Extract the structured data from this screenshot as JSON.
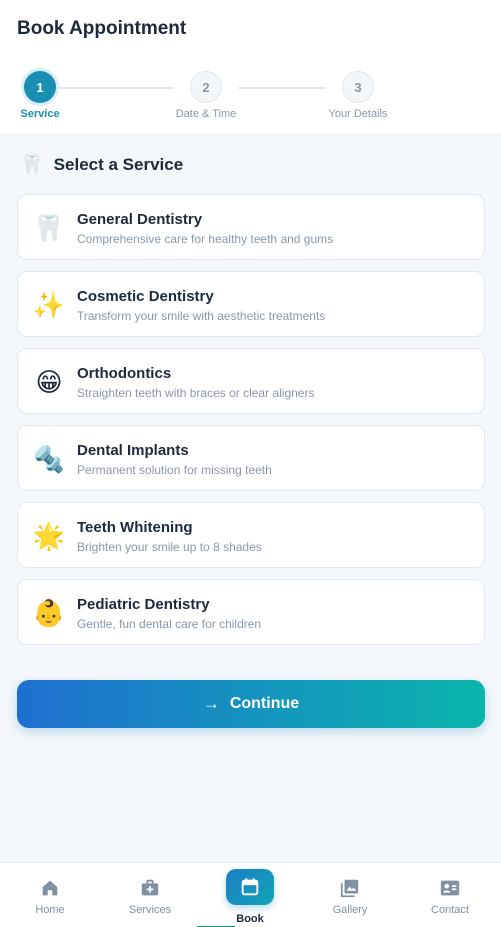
{
  "header": {
    "title": "Book Appointment"
  },
  "steps": [
    {
      "number": "1",
      "label": "Service",
      "state": "active"
    },
    {
      "number": "2",
      "label": "Date & Time",
      "state": "inactive"
    },
    {
      "number": "3",
      "label": "Your Details",
      "state": "inactive"
    }
  ],
  "section": {
    "icon": "tooth-icon",
    "emoji": "🦷",
    "title": "Select a Service"
  },
  "services": [
    {
      "emoji": "🦷",
      "icon": "tooth-icon",
      "title": "General Dentistry",
      "description": "Comprehensive care for healthy teeth and gums"
    },
    {
      "emoji": "✨",
      "icon": "sparkles-icon",
      "title": "Cosmetic Dentistry",
      "description": "Transform your smile with aesthetic treatments"
    },
    {
      "emoji": "😁",
      "icon": "grin-icon",
      "title": "Orthodontics",
      "description": "Straighten teeth with braces or clear aligners"
    },
    {
      "emoji": "🔩",
      "icon": "bolt-icon",
      "title": "Dental Implants",
      "description": "Permanent solution for missing teeth"
    },
    {
      "emoji": "🌟",
      "icon": "star-icon",
      "title": "Teeth Whitening",
      "description": "Brighten your smile up to 8 shades"
    },
    {
      "emoji": "👶",
      "icon": "baby-icon",
      "title": "Pediatric Dentistry",
      "description": "Gentle, fun dental care for children"
    }
  ],
  "continue": {
    "label": "Continue",
    "icon": "arrow-right-icon"
  },
  "nav": [
    {
      "label": "Home",
      "icon": "home-icon",
      "active": false
    },
    {
      "label": "Services",
      "icon": "medical-bag-icon",
      "active": false
    },
    {
      "label": "Book",
      "icon": "calendar-icon",
      "active": true
    },
    {
      "label": "Gallery",
      "icon": "gallery-icon",
      "active": false
    },
    {
      "label": "Contact",
      "icon": "contact-card-icon",
      "active": false
    }
  ],
  "colors": {
    "accent": "#1b8fb3",
    "gradient_start": "#1f6fd0",
    "gradient_end": "#0ab5ad",
    "muted_text": "#8a97a8"
  }
}
